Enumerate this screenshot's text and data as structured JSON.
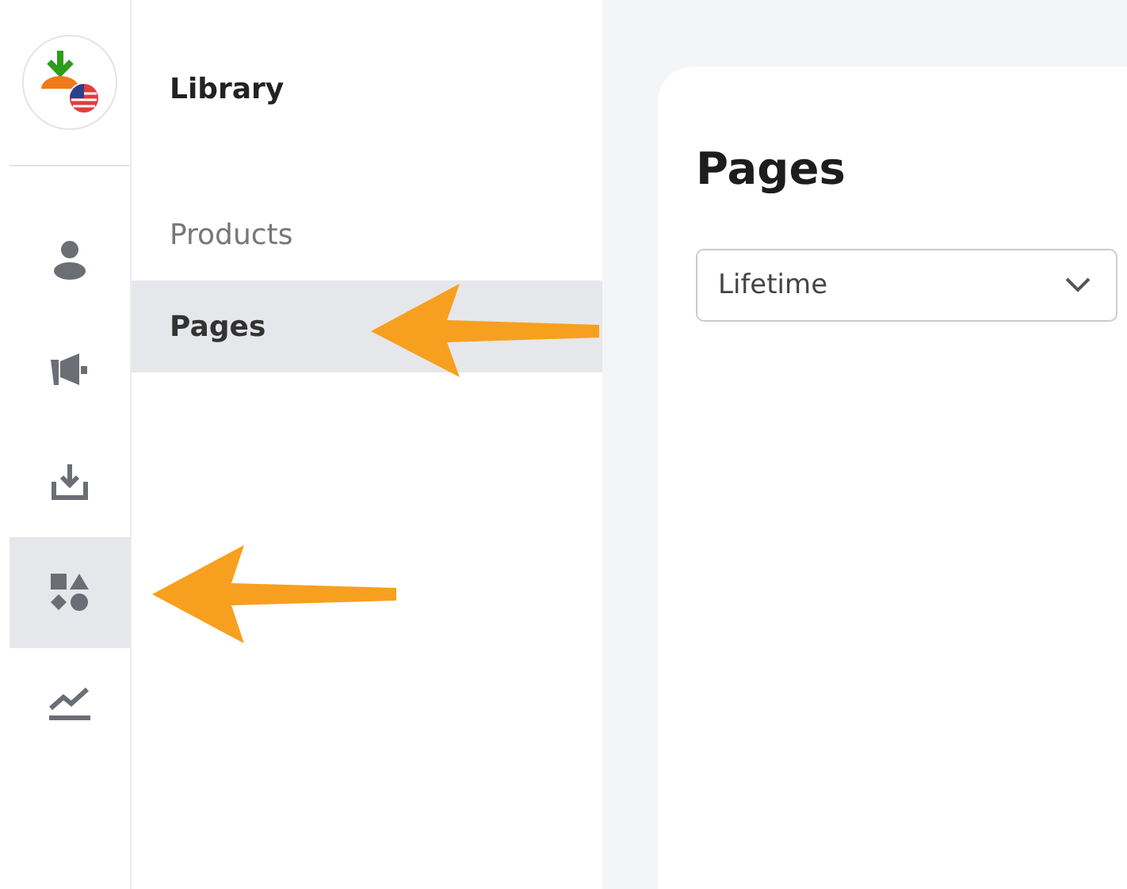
{
  "rail": {
    "items": [
      {
        "selected": false
      },
      {
        "selected": false
      },
      {
        "selected": false
      },
      {
        "selected": true
      },
      {
        "selected": false
      }
    ]
  },
  "sidebar": {
    "title": "Library",
    "items": [
      {
        "label": "Products",
        "selected": false
      },
      {
        "label": "Pages",
        "selected": true
      }
    ]
  },
  "main": {
    "title": "Pages",
    "filter": {
      "value": "Lifetime"
    }
  }
}
